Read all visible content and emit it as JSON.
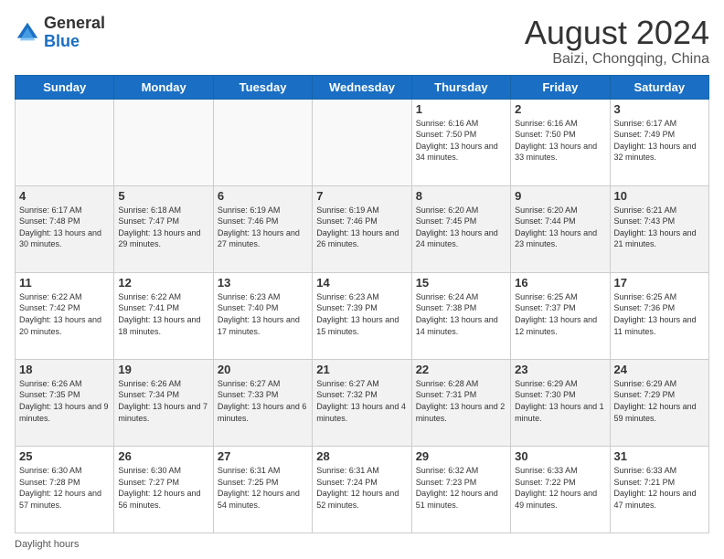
{
  "header": {
    "logo_general": "General",
    "logo_blue": "Blue",
    "month_title": "August 2024",
    "location": "Baizi, Chongqing, China"
  },
  "calendar": {
    "days_of_week": [
      "Sunday",
      "Monday",
      "Tuesday",
      "Wednesday",
      "Thursday",
      "Friday",
      "Saturday"
    ],
    "weeks": [
      [
        {
          "day": "",
          "info": ""
        },
        {
          "day": "",
          "info": ""
        },
        {
          "day": "",
          "info": ""
        },
        {
          "day": "",
          "info": ""
        },
        {
          "day": "1",
          "info": "Sunrise: 6:16 AM\nSunset: 7:50 PM\nDaylight: 13 hours\nand 34 minutes."
        },
        {
          "day": "2",
          "info": "Sunrise: 6:16 AM\nSunset: 7:50 PM\nDaylight: 13 hours\nand 33 minutes."
        },
        {
          "day": "3",
          "info": "Sunrise: 6:17 AM\nSunset: 7:49 PM\nDaylight: 13 hours\nand 32 minutes."
        }
      ],
      [
        {
          "day": "4",
          "info": "Sunrise: 6:17 AM\nSunset: 7:48 PM\nDaylight: 13 hours\nand 30 minutes."
        },
        {
          "day": "5",
          "info": "Sunrise: 6:18 AM\nSunset: 7:47 PM\nDaylight: 13 hours\nand 29 minutes."
        },
        {
          "day": "6",
          "info": "Sunrise: 6:19 AM\nSunset: 7:46 PM\nDaylight: 13 hours\nand 27 minutes."
        },
        {
          "day": "7",
          "info": "Sunrise: 6:19 AM\nSunset: 7:46 PM\nDaylight: 13 hours\nand 26 minutes."
        },
        {
          "day": "8",
          "info": "Sunrise: 6:20 AM\nSunset: 7:45 PM\nDaylight: 13 hours\nand 24 minutes."
        },
        {
          "day": "9",
          "info": "Sunrise: 6:20 AM\nSunset: 7:44 PM\nDaylight: 13 hours\nand 23 minutes."
        },
        {
          "day": "10",
          "info": "Sunrise: 6:21 AM\nSunset: 7:43 PM\nDaylight: 13 hours\nand 21 minutes."
        }
      ],
      [
        {
          "day": "11",
          "info": "Sunrise: 6:22 AM\nSunset: 7:42 PM\nDaylight: 13 hours\nand 20 minutes."
        },
        {
          "day": "12",
          "info": "Sunrise: 6:22 AM\nSunset: 7:41 PM\nDaylight: 13 hours\nand 18 minutes."
        },
        {
          "day": "13",
          "info": "Sunrise: 6:23 AM\nSunset: 7:40 PM\nDaylight: 13 hours\nand 17 minutes."
        },
        {
          "day": "14",
          "info": "Sunrise: 6:23 AM\nSunset: 7:39 PM\nDaylight: 13 hours\nand 15 minutes."
        },
        {
          "day": "15",
          "info": "Sunrise: 6:24 AM\nSunset: 7:38 PM\nDaylight: 13 hours\nand 14 minutes."
        },
        {
          "day": "16",
          "info": "Sunrise: 6:25 AM\nSunset: 7:37 PM\nDaylight: 13 hours\nand 12 minutes."
        },
        {
          "day": "17",
          "info": "Sunrise: 6:25 AM\nSunset: 7:36 PM\nDaylight: 13 hours\nand 11 minutes."
        }
      ],
      [
        {
          "day": "18",
          "info": "Sunrise: 6:26 AM\nSunset: 7:35 PM\nDaylight: 13 hours\nand 9 minutes."
        },
        {
          "day": "19",
          "info": "Sunrise: 6:26 AM\nSunset: 7:34 PM\nDaylight: 13 hours\nand 7 minutes."
        },
        {
          "day": "20",
          "info": "Sunrise: 6:27 AM\nSunset: 7:33 PM\nDaylight: 13 hours\nand 6 minutes."
        },
        {
          "day": "21",
          "info": "Sunrise: 6:27 AM\nSunset: 7:32 PM\nDaylight: 13 hours\nand 4 minutes."
        },
        {
          "day": "22",
          "info": "Sunrise: 6:28 AM\nSunset: 7:31 PM\nDaylight: 13 hours\nand 2 minutes."
        },
        {
          "day": "23",
          "info": "Sunrise: 6:29 AM\nSunset: 7:30 PM\nDaylight: 13 hours\nand 1 minute."
        },
        {
          "day": "24",
          "info": "Sunrise: 6:29 AM\nSunset: 7:29 PM\nDaylight: 12 hours\nand 59 minutes."
        }
      ],
      [
        {
          "day": "25",
          "info": "Sunrise: 6:30 AM\nSunset: 7:28 PM\nDaylight: 12 hours\nand 57 minutes."
        },
        {
          "day": "26",
          "info": "Sunrise: 6:30 AM\nSunset: 7:27 PM\nDaylight: 12 hours\nand 56 minutes."
        },
        {
          "day": "27",
          "info": "Sunrise: 6:31 AM\nSunset: 7:25 PM\nDaylight: 12 hours\nand 54 minutes."
        },
        {
          "day": "28",
          "info": "Sunrise: 6:31 AM\nSunset: 7:24 PM\nDaylight: 12 hours\nand 52 minutes."
        },
        {
          "day": "29",
          "info": "Sunrise: 6:32 AM\nSunset: 7:23 PM\nDaylight: 12 hours\nand 51 minutes."
        },
        {
          "day": "30",
          "info": "Sunrise: 6:33 AM\nSunset: 7:22 PM\nDaylight: 12 hours\nand 49 minutes."
        },
        {
          "day": "31",
          "info": "Sunrise: 6:33 AM\nSunset: 7:21 PM\nDaylight: 12 hours\nand 47 minutes."
        }
      ]
    ]
  },
  "footer": {
    "label": "Daylight hours"
  }
}
